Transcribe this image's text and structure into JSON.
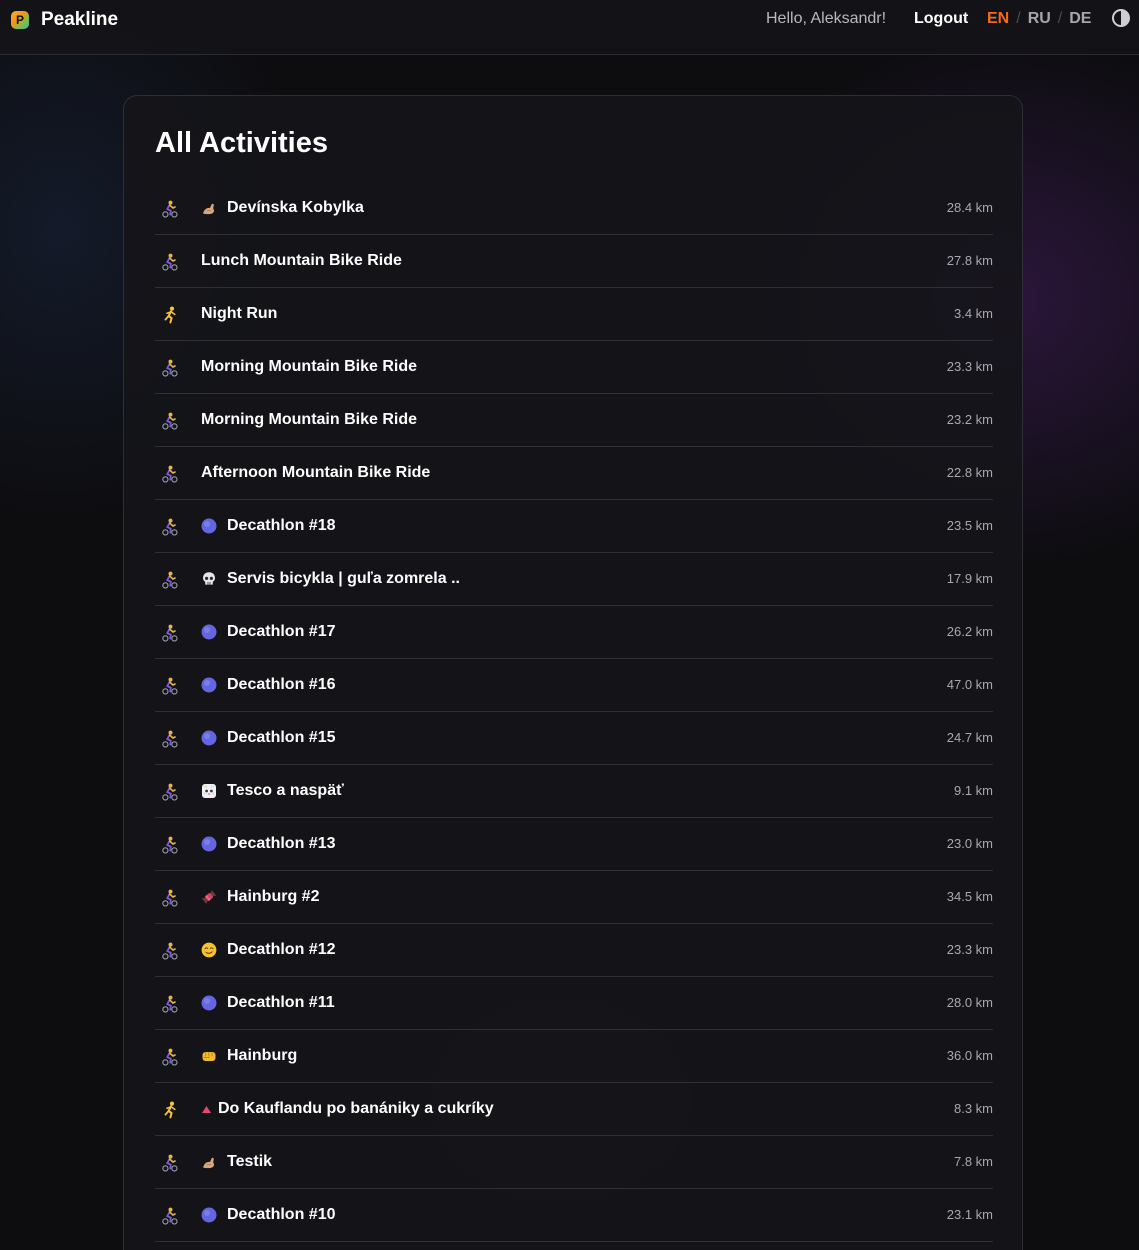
{
  "header": {
    "brand": "Peakline",
    "logo_letter": "P",
    "greeting": "Hello, Aleksandr!",
    "logout_label": "Logout",
    "languages": [
      "EN",
      "RU",
      "DE"
    ],
    "active_language": "EN",
    "theme_toggle_icon": "contrast-icon",
    "accent_color": "#f26b1d"
  },
  "main": {
    "title": "All Activities",
    "activities": [
      {
        "type": "ride",
        "emoji": "flexed-arm",
        "name": "Devínska Kobylka",
        "distance": "28.4 km"
      },
      {
        "type": "ride",
        "emoji": "",
        "name": "Lunch Mountain Bike Ride",
        "distance": "27.8 km"
      },
      {
        "type": "run",
        "emoji": "",
        "name": "Night Run",
        "distance": "3.4 km"
      },
      {
        "type": "ride",
        "emoji": "",
        "name": "Morning Mountain Bike Ride",
        "distance": "23.3 km"
      },
      {
        "type": "ride",
        "emoji": "",
        "name": "Morning Mountain Bike Ride",
        "distance": "23.2 km"
      },
      {
        "type": "ride",
        "emoji": "",
        "name": "Afternoon Mountain Bike Ride",
        "distance": "22.8 km"
      },
      {
        "type": "ride",
        "emoji": "blue-circle",
        "name": "Decathlon #18",
        "distance": "23.5 km"
      },
      {
        "type": "ride",
        "emoji": "skull",
        "name": "Servis bicykla | guľa zomrela ..",
        "distance": "17.9 km"
      },
      {
        "type": "ride",
        "emoji": "blue-circle",
        "name": "Decathlon #17",
        "distance": "26.2 km"
      },
      {
        "type": "ride",
        "emoji": "blue-circle",
        "name": "Decathlon #16",
        "distance": "47.0 km"
      },
      {
        "type": "ride",
        "emoji": "blue-circle",
        "name": "Decathlon #15",
        "distance": "24.7 km"
      },
      {
        "type": "ride",
        "emoji": "cat-face",
        "name": "Tesco a naspäť",
        "distance": "9.1 km"
      },
      {
        "type": "ride",
        "emoji": "blue-circle",
        "name": "Decathlon #13",
        "distance": "23.0 km"
      },
      {
        "type": "ride",
        "emoji": "candy",
        "name": "Hainburg #2",
        "distance": "34.5 km"
      },
      {
        "type": "ride",
        "emoji": "smirk-face",
        "name": "Decathlon #12",
        "distance": "23.3 km"
      },
      {
        "type": "ride",
        "emoji": "blue-circle",
        "name": "Decathlon #11",
        "distance": "28.0 km"
      },
      {
        "type": "ride",
        "emoji": "fist",
        "name": "Hainburg",
        "distance": "36.0 km"
      },
      {
        "type": "run",
        "emoji": "red-triangle",
        "name": "Do Kauflandu po banániky a cukríky",
        "distance": "8.3 km"
      },
      {
        "type": "ride",
        "emoji": "flexed-arm",
        "name": "Testik",
        "distance": "7.8 km"
      },
      {
        "type": "ride",
        "emoji": "blue-circle",
        "name": "Decathlon #10",
        "distance": "23.1 km"
      }
    ]
  },
  "colors": {
    "background": "#0d0d10",
    "card": "#151519",
    "row_divider": "#2f2f35",
    "distance_text": "#a8a8ae",
    "ride_icon": "#e8b34a",
    "run_icon": "#f5c33b"
  }
}
